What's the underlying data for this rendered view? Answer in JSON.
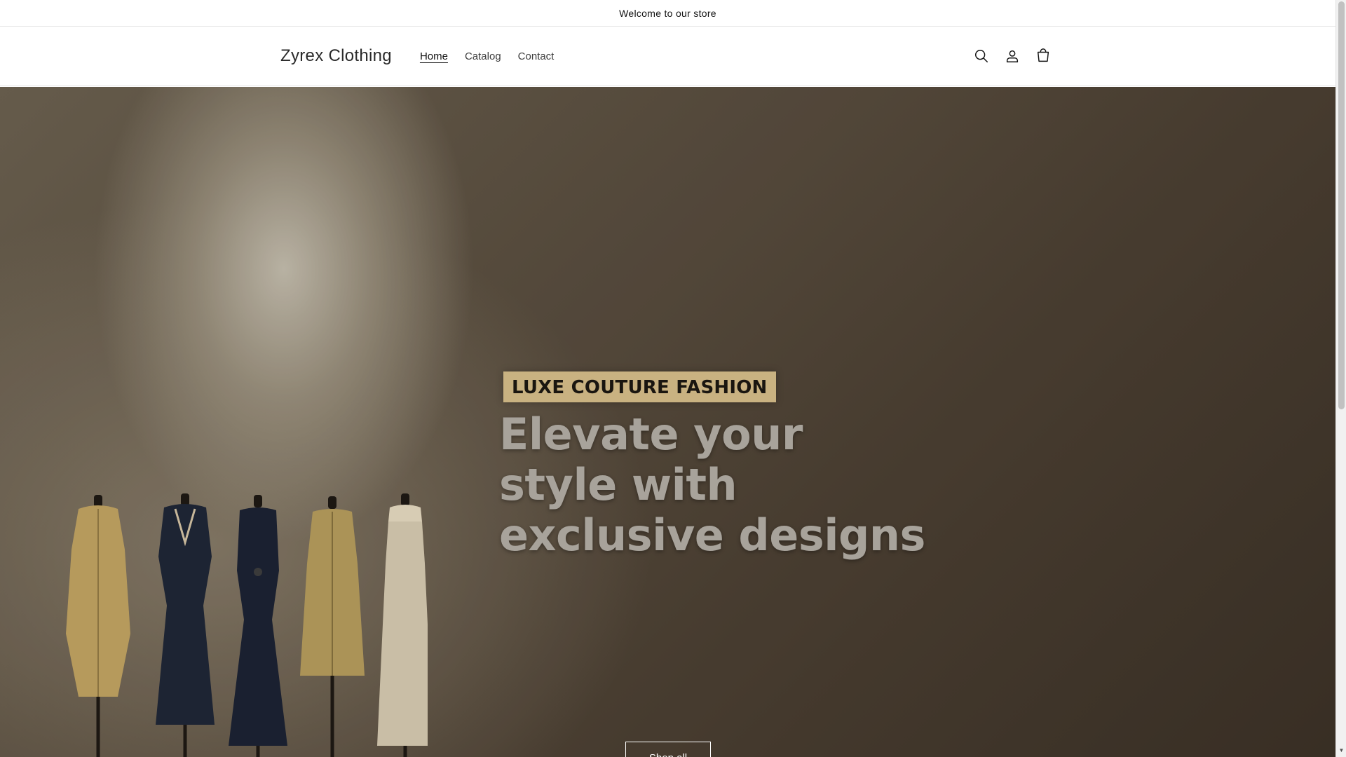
{
  "announcement": {
    "text": "Welcome to our store"
  },
  "header": {
    "logo": "Zyrex Clothing",
    "nav": [
      {
        "label": "Home",
        "active": true
      },
      {
        "label": "Catalog",
        "active": false
      },
      {
        "label": "Contact",
        "active": false
      }
    ],
    "icons": [
      "search-icon",
      "account-icon",
      "cart-icon"
    ]
  },
  "hero": {
    "tag": "LUXE COUTURE FASHION",
    "headline": "Elevate your style with exclusive designs",
    "button_label": "Shop all"
  },
  "colors": {
    "tag_background": "#c9b281",
    "headline_text": "#a8a39b",
    "hero_dark": "#4a3e31"
  }
}
